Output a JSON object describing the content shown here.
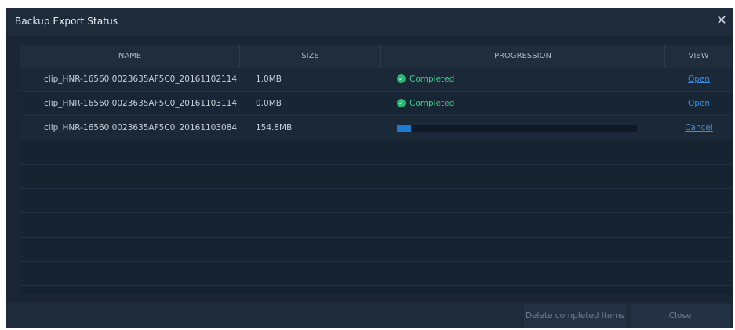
{
  "dialog": {
    "title": "Backup Export Status",
    "close_icon": "close-icon"
  },
  "table": {
    "headers": {
      "name": "NAME",
      "size": "SIZE",
      "progression": "PROGRESSION",
      "view": "VIEW"
    },
    "rows": [
      {
        "name": "clip_HNR-16560 0023635AF5C0_20161102114",
        "size": "1.0MB",
        "status": "Completed",
        "status_icon": "check-circle-icon",
        "view": "Open"
      },
      {
        "name": "clip_HNR-16560 0023635AF5C0_20161103114",
        "size": "0.0MB",
        "status": "Completed",
        "status_icon": "check-circle-icon",
        "view": "Open"
      },
      {
        "name": "clip_HNR-16560 0023635AF5C0_20161103084",
        "size": "154.8MB",
        "progress_fraction": 0.06,
        "view": "Cancel"
      }
    ]
  },
  "footer": {
    "delete_label": "Delete completed items",
    "close_label": "Close"
  },
  "colors": {
    "completed": "#3fcf86",
    "progress_fill": "#1f7ad6",
    "link": "#3e8fe0"
  }
}
